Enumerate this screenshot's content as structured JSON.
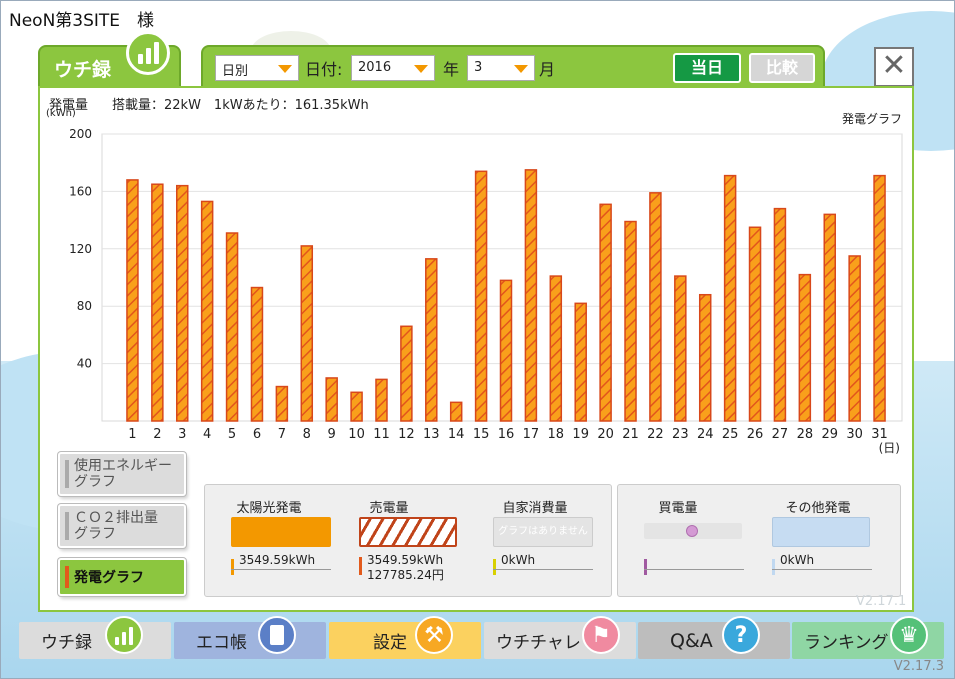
{
  "app": {
    "site_title": "NeoN第3SITE　様",
    "tab_label": "ウチ録",
    "version": "V2.17.3",
    "version_faint": "V2.17.1"
  },
  "toolbar": {
    "period_select": "日別",
    "date_label": "日付:",
    "year_select": "2016",
    "year_label": "年",
    "month_select": "3",
    "month_label": "月",
    "today_button": "当日",
    "compare_button": "比較",
    "close_glyph": "✕"
  },
  "chart_header": {
    "y_title": "発電量",
    "y_unit": "(kWh)",
    "capacity_text": "搭載量：22kW　1kWあたり：161.35kWh",
    "chart_name": "発電グラフ"
  },
  "side_buttons": [
    {
      "label_line1": "使用エネルギー",
      "label_line2": "グラフ",
      "active": false
    },
    {
      "label_line1": "ＣＯ２排出量",
      "label_line2": "グラフ",
      "active": false
    },
    {
      "label_line1": "発電グラフ",
      "label_line2": "",
      "active": true
    }
  ],
  "legend": {
    "solar": {
      "title": "太陽光発電",
      "value": "3549.59kWh",
      "color": "#f39800"
    },
    "sold": {
      "title": "売電量",
      "value": "3549.59kWh",
      "value2": "127785.24円",
      "color": "#e25a1c"
    },
    "self": {
      "title": "自家消費量",
      "note": "グラフはありません",
      "value": "0kWh",
      "color": "#d8d000"
    },
    "bought": {
      "title": "買電量",
      "color": "#a05aa0"
    },
    "other": {
      "title": "その他発電",
      "value": "0kWh",
      "color": "#c0d8f0"
    }
  },
  "nav": [
    {
      "label": "ウチ録",
      "icon": "bar-chart-icon",
      "color": "#8cc63f"
    },
    {
      "label": "エコ帳",
      "icon": "notebook-icon",
      "color": "#5b7fc7"
    },
    {
      "label": "設定",
      "icon": "wrench-icon",
      "color": "#f7a823"
    },
    {
      "label": "ウチチャレ",
      "icon": "flag-icon",
      "color": "#f08aa0"
    },
    {
      "label": "Q&A",
      "icon": "question-icon",
      "color": "#3aa8dc"
    },
    {
      "label": "ランキング",
      "icon": "crown-icon",
      "color": "#55c178"
    }
  ],
  "chart_data": {
    "type": "bar",
    "title": "発電グラフ",
    "ylabel": "発電量 (kWh)",
    "xlabel": "(日)",
    "ylim": [
      0,
      200
    ],
    "yticks": [
      40,
      80,
      120,
      160,
      200
    ],
    "grid": true,
    "categories": [
      "1",
      "2",
      "3",
      "4",
      "5",
      "6",
      "7",
      "8",
      "9",
      "10",
      "11",
      "12",
      "13",
      "14",
      "15",
      "16",
      "17",
      "18",
      "19",
      "20",
      "21",
      "22",
      "23",
      "24",
      "25",
      "26",
      "27",
      "28",
      "29",
      "30",
      "31"
    ],
    "series": [
      {
        "name": "売電量",
        "values": [
          168,
          165,
          164,
          153,
          131,
          93,
          24,
          122,
          30,
          20,
          29,
          66,
          113,
          13,
          174,
          98,
          175,
          101,
          82,
          151,
          139,
          159,
          101,
          88,
          171,
          135,
          148,
          102,
          144,
          115,
          171
        ]
      }
    ]
  }
}
